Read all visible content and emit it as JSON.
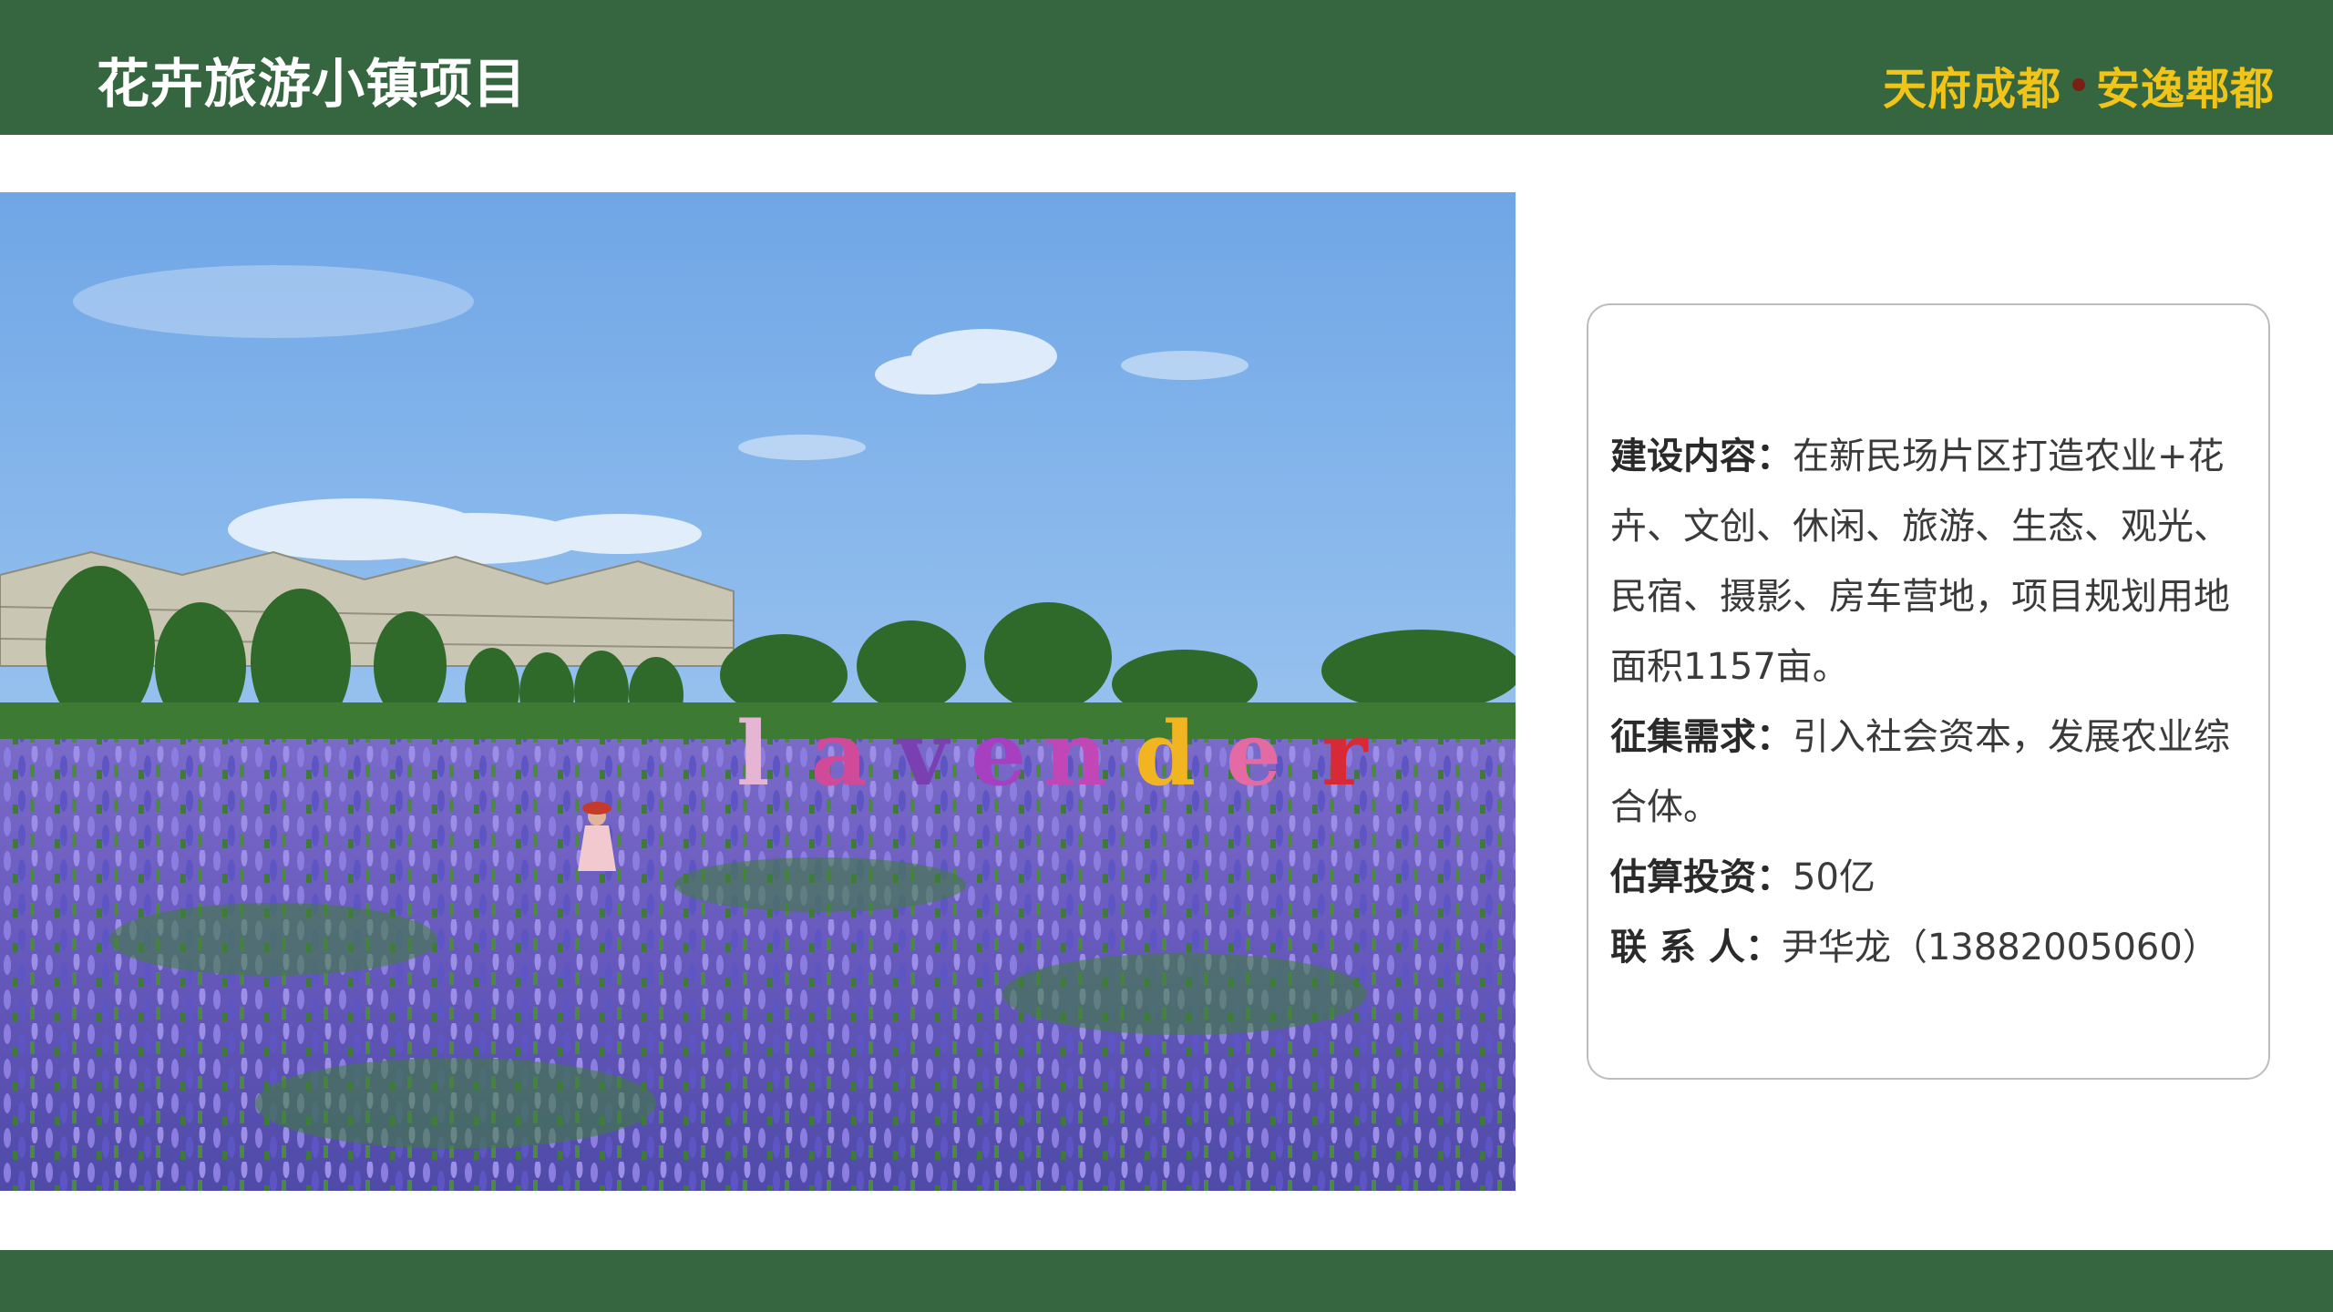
{
  "header": {
    "title": "花卉旅游小镇项目",
    "brand_left": "天府成都",
    "brand_right": "安逸郫都"
  },
  "photo": {
    "sign_letters": [
      "l",
      "a",
      "v",
      "e",
      "n",
      "d",
      "e",
      "r"
    ]
  },
  "info": {
    "construction_label": "建设内容：",
    "construction_value": "在新民场片区打造农业+花卉、文创、休闲、旅游、生态、观光、民宿、摄影、房车营地，项目规划用地面积1157亩。",
    "demand_label": "征集需求：",
    "demand_value": "引入社会资本，发展农业综合体。",
    "investment_label": "估算投资：",
    "investment_value": "50亿",
    "contact_label": "联 系 人：",
    "contact_value": "尹华龙（13882005060）"
  },
  "colors": {
    "bar_green": "#356640",
    "brand_yellow": "#f0c418"
  }
}
